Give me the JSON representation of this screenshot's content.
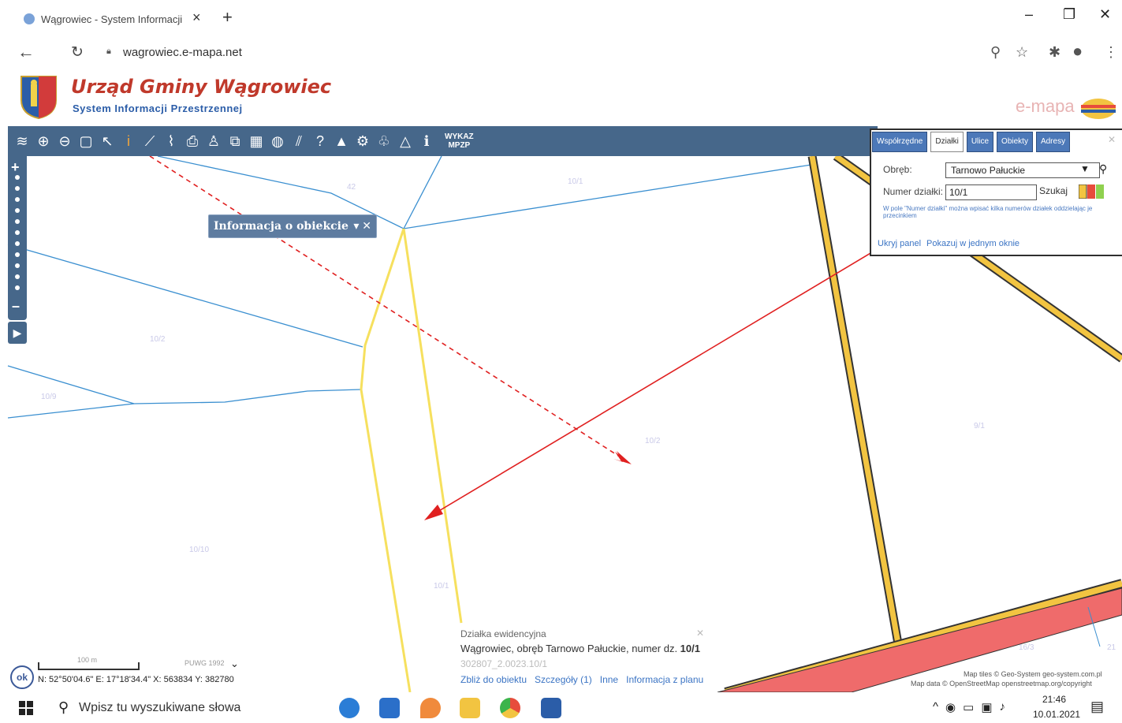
{
  "browser": {
    "tab_title": "Wągrowiec - System Informacji",
    "tab_close": "×",
    "new_tab": "+",
    "url": "wagrowiec.e-mapa.net",
    "window_controls": [
      "–",
      "❐",
      "✕"
    ],
    "icons": [
      "zoom-icon",
      "star-icon",
      "extensions-icon",
      "profile-icon",
      "menu-icon"
    ]
  },
  "site": {
    "title": "Urząd Gminy Wągrowiec",
    "subtitle": "System Informacji Przestrzennej",
    "brand": "e-mapa",
    "title_color": "#c0392b",
    "subtitle_color": "#2b5da8"
  },
  "toolbar": {
    "color": "#46678a",
    "wykaz_line1": "WYKAZ",
    "wykaz_line2": "MPZP"
  },
  "info_popup": {
    "title": "Informacja o obiekcie",
    "controls": "▾ ✕"
  },
  "panel": {
    "tabs": [
      "Współrzędne",
      "Działki",
      "Ulice",
      "Obiekty",
      "Adresy"
    ],
    "active_tab": "Działki",
    "obreb_label": "Obręb:",
    "obreb_value": "Tarnowo Pałuckie",
    "numer_label": "Numer działki:",
    "numer_value": "10/1",
    "search_button": "Szukaj",
    "hint": "W pole \"Numer działki\" można wpisać kilka numerów działek oddzielając je przecinkiem",
    "hide_link": "Ukryj panel",
    "single_window_link": "Pokazuj w jednym oknie"
  },
  "object_info": {
    "type": "Działka ewidencyjna",
    "desc_prefix": "Wągrowiec, obręb Tarnowo Pałuckie, numer dz. ",
    "desc_number": "10/1",
    "id": "302807_2.0023.10/1",
    "links": [
      "Zbliż do obiektu",
      "Szczegóły (1)",
      "Inne",
      "Informacja z planu"
    ]
  },
  "status": {
    "ok": "ok",
    "scale_label": "100 m",
    "crs": "PUWG 1992",
    "coords": "N: 52°50'04.6\"  E: 17°18'34.4\"  X: 563834    Y: 382780",
    "attribution1": "Map tiles © Geo-System geo-system.com.pl",
    "attribution2": "Map data © OpenStreetMap openstreetmap.org/copyright"
  },
  "map_labels": [
    "42",
    "10/1",
    "10/2",
    "10/9",
    "10/10",
    "10/1",
    "9/1",
    "16/3",
    "10/2",
    "21"
  ],
  "taskbar": {
    "search_placeholder": "Wpisz tu wyszukiwane słowa",
    "time": "21:46",
    "date": "10.01.2021",
    "apps": [
      "edge-icon",
      "mail-icon",
      "app-icon",
      "files-icon",
      "chrome-icon",
      "word-icon"
    ]
  }
}
